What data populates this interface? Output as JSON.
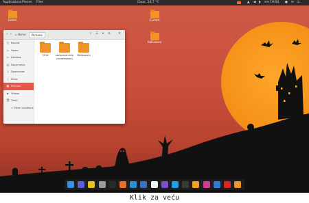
{
  "topbar": {
    "applications": "Applications",
    "places": "Places",
    "files": "Files",
    "weather": "Clear, 24.7 °C",
    "clock": "sre 19:04"
  },
  "desktop_icons": [
    {
      "label": "Home"
    },
    {
      "label": "Current"
    },
    {
      "label": "Halloween"
    }
  ],
  "window": {
    "crumb_home": "Home",
    "crumb_current": "Pictures",
    "sidebar": [
      {
        "label": "Recent",
        "icon": "clock-icon"
      },
      {
        "label": "Home",
        "icon": "home-icon"
      },
      {
        "label": "Desktop",
        "icon": "desktop-icon"
      },
      {
        "label": "Documents",
        "icon": "document-icon"
      },
      {
        "label": "Downloads",
        "icon": "download-icon"
      },
      {
        "label": "Music",
        "icon": "music-icon"
      },
      {
        "label": "Pictures",
        "icon": "picture-icon"
      },
      {
        "label": "Videos",
        "icon": "video-icon"
      },
      {
        "label": "Trash",
        "icon": "trash-icon"
      },
      {
        "label": "+ Other Locations",
        "icon": "plus-icon"
      }
    ],
    "active_sidebar": "Pictures",
    "files": [
      {
        "name": "2016"
      },
      {
        "name": "zaslonske slike (screenshots)"
      },
      {
        "name": "Wallpapers"
      }
    ]
  },
  "dock": {
    "apps": [
      "files-icon",
      "settings-icon",
      "software-icon",
      "package-icon",
      "terminal-icon",
      "slideshow-icon",
      "firefox-icon",
      "mail-icon",
      "clipboard-icon",
      "viber-icon",
      "skype-icon",
      "music-icon",
      "disk-icon",
      "media-player-icon",
      "photos-icon",
      "youtube-icon",
      "folder-icon"
    ],
    "colors": [
      "#3a8ee6",
      "#5b5fd6",
      "#e8c21c",
      "#9a9a9a",
      "#2b2b2b",
      "#e86d25",
      "#2a8fd3",
      "#3a6fc2",
      "#f3f3f3",
      "#7b4fc8",
      "#1da1e6",
      "#3a3a3a",
      "#f0a51e",
      "#d13c8c",
      "#2e7bd6",
      "#d92525",
      "#f0932b"
    ]
  },
  "caption": "Klik za veću"
}
